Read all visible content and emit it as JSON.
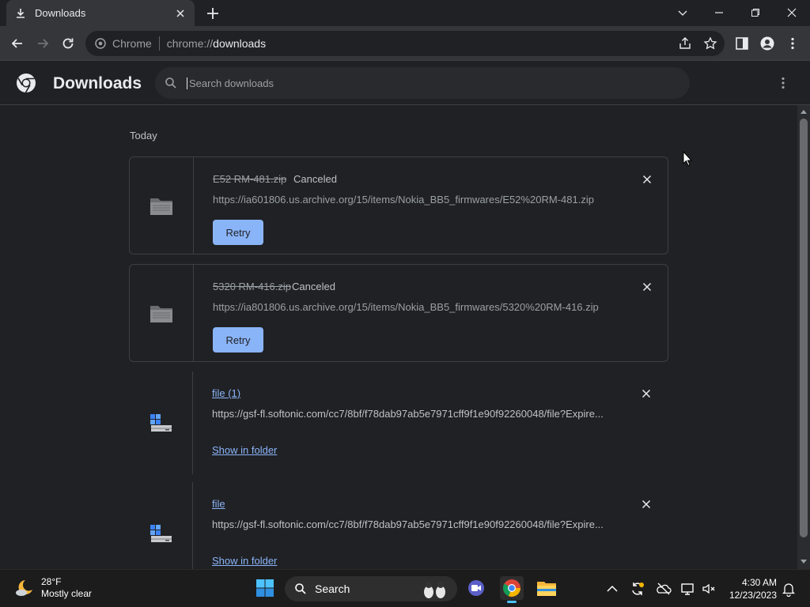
{
  "tab": {
    "title": "Downloads"
  },
  "omnibox": {
    "site_label": "Chrome",
    "url_scheme": "chrome://",
    "url_host": "downloads"
  },
  "header": {
    "title": "Downloads",
    "search_placeholder": "Search downloads"
  },
  "section": {
    "label": "Today"
  },
  "downloads": [
    {
      "filename": "E52 RM-481.zip",
      "status": "Canceled",
      "url": "https://ia601806.us.archive.org/15/items/Nokia_BB5_firmwares/E52%20RM-481.zip",
      "action": "Retry"
    },
    {
      "filename": "5320 RM-416.zip",
      "status": "Canceled",
      "url": "https://ia801806.us.archive.org/15/items/Nokia_BB5_firmwares/5320%20RM-416.zip",
      "action": "Retry"
    },
    {
      "filename": "file (1)",
      "url": "https://gsf-fl.softonic.com/cc7/8bf/f78dab97ab5e7971cff9f1e90f92260048/file?Expire...",
      "action": "Show in folder"
    },
    {
      "filename": "file",
      "url": "https://gsf-fl.softonic.com/cc7/8bf/f78dab97ab5e7971cff9f1e90f92260048/file?Expire...",
      "action": "Show in folder"
    }
  ],
  "taskbar": {
    "weather_temp": "28°F",
    "weather_desc": "Mostly clear",
    "search_label": "Search",
    "time": "4:30 AM",
    "date": "12/23/2023"
  },
  "colors": {
    "accent": "#8ab4f8",
    "background": "#202124",
    "toolbar": "#35363a"
  }
}
